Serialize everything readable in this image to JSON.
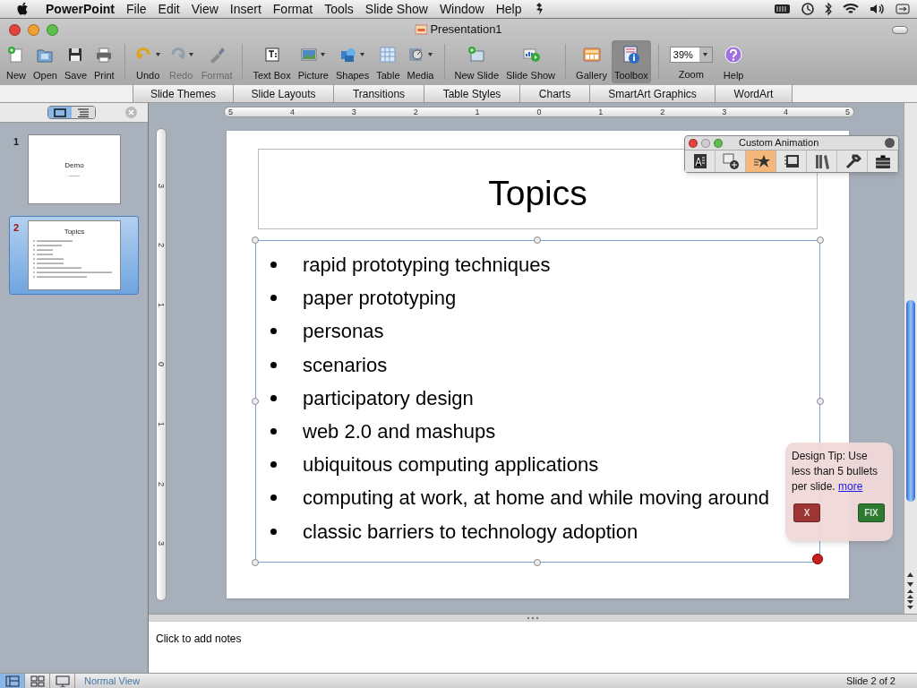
{
  "menu_bar": {
    "app": "PowerPoint",
    "items": [
      "File",
      "Edit",
      "View",
      "Insert",
      "Format",
      "Tools",
      "Slide Show",
      "Window",
      "Help"
    ]
  },
  "window": {
    "title": "Presentation1"
  },
  "toolbar": {
    "items": [
      {
        "label": "New",
        "disabled": false,
        "pressed": false
      },
      {
        "label": "Open",
        "disabled": false,
        "pressed": false
      },
      {
        "label": "Save",
        "disabled": false,
        "pressed": false
      },
      {
        "label": "Print",
        "disabled": false,
        "pressed": false
      },
      {
        "label": "Undo",
        "disabled": false,
        "pressed": false
      },
      {
        "label": "Redo",
        "disabled": true,
        "pressed": false
      },
      {
        "label": "Format",
        "disabled": true,
        "pressed": false
      },
      {
        "label": "Text Box",
        "disabled": false,
        "pressed": false
      },
      {
        "label": "Picture",
        "disabled": false,
        "pressed": false
      },
      {
        "label": "Shapes",
        "disabled": false,
        "pressed": false
      },
      {
        "label": "Table",
        "disabled": false,
        "pressed": false
      },
      {
        "label": "Media",
        "disabled": false,
        "pressed": false
      },
      {
        "label": "New Slide",
        "disabled": false,
        "pressed": false
      },
      {
        "label": "Slide Show",
        "disabled": false,
        "pressed": false
      },
      {
        "label": "Gallery",
        "disabled": false,
        "pressed": false
      },
      {
        "label": "Toolbox",
        "disabled": false,
        "pressed": true
      }
    ],
    "zoom": {
      "label": "Zoom",
      "value": "39%"
    },
    "help": {
      "label": "Help"
    }
  },
  "ribbon_tabs": [
    "Slide Themes",
    "Slide Layouts",
    "Transitions",
    "Table Styles",
    "Charts",
    "SmartArt Graphics",
    "WordArt"
  ],
  "slides_pane": {
    "thumbnails": [
      {
        "number": "1",
        "selected": false,
        "title": "Demo",
        "kind": "title"
      },
      {
        "number": "2",
        "selected": true,
        "title": "Topics",
        "kind": "bullets"
      }
    ]
  },
  "rulers": {
    "horizontal": [
      "5",
      "4",
      "3",
      "2",
      "1",
      "0",
      "1",
      "2",
      "3",
      "4",
      "5"
    ],
    "vertical": [
      "3",
      "2",
      "1",
      "0",
      "1",
      "2",
      "3"
    ]
  },
  "slide": {
    "title": "Topics",
    "bullets": [
      "rapid prototyping techniques",
      "paper prototyping",
      "personas",
      "scenarios",
      "participatory design",
      "web 2.0 and mashups",
      "ubiquitous computing applications",
      "computing at work, at home and while moving around",
      "classic barriers to technology adoption"
    ]
  },
  "custom_animation": {
    "title": "Custom Animation",
    "tools": [
      {
        "selected": false
      },
      {
        "selected": false
      },
      {
        "selected": true
      },
      {
        "selected": false
      },
      {
        "selected": false
      },
      {
        "selected": false
      },
      {
        "selected": false
      }
    ]
  },
  "design_tip": {
    "text": "Design Tip:  Use less than 5 bullets per slide.",
    "link": "more",
    "buttons": [
      "X",
      "FIX"
    ]
  },
  "notes": {
    "placeholder": "Click to add notes"
  },
  "status_bar": {
    "views": [
      {
        "selected": true
      },
      {
        "selected": false
      },
      {
        "selected": false
      }
    ],
    "view_name": "Normal View",
    "slide_position": "Slide 2 of 2"
  }
}
